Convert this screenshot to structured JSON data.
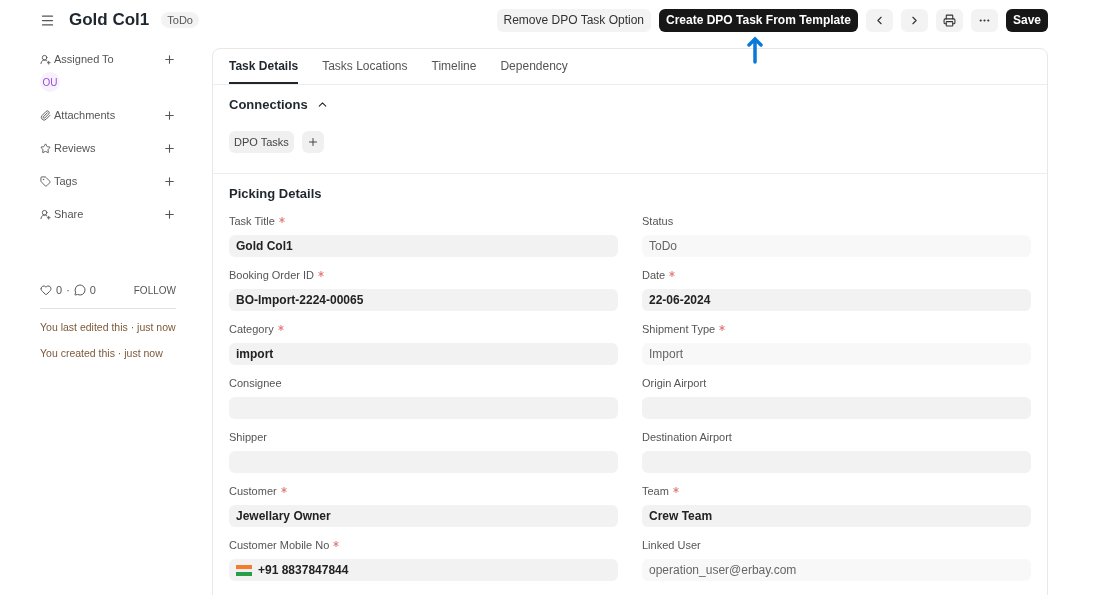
{
  "header": {
    "title": "Gold Col1",
    "status_badge": "ToDo",
    "buttons": [
      {
        "kind": "secondary",
        "label": "Remove DPO Task Option"
      },
      {
        "kind": "primary",
        "label": "Create DPO Task From Template"
      },
      {
        "kind": "icon"
      },
      {
        "kind": "icon"
      },
      {
        "kind": "icon"
      },
      {
        "kind": "icon"
      },
      {
        "kind": "primary",
        "label": "Save"
      }
    ]
  },
  "sidebar": {
    "items": [
      {
        "label": "Assigned To"
      },
      {
        "label": "Attachments"
      },
      {
        "label": "Reviews"
      },
      {
        "label": "Tags"
      },
      {
        "label": "Share"
      }
    ],
    "assignee": "OU",
    "likes": "0",
    "separator": "·",
    "comments": "0",
    "follow": "FOLLOW",
    "activity": [
      "You last edited this · just now",
      "You created this · just now"
    ]
  },
  "tabs": [
    {
      "label": "Task Details",
      "selected": true
    },
    {
      "label": "Tasks Locations",
      "selected": false
    },
    {
      "label": "Timeline",
      "selected": false
    },
    {
      "label": "Dependency",
      "selected": false
    }
  ],
  "connections": {
    "title": "Connections",
    "expanded": true,
    "items": [
      "DPO Tasks"
    ]
  },
  "section": {
    "title": "Picking Details",
    "fields": [
      {
        "label": "Task Title",
        "required": true,
        "value": "Gold Col1",
        "readonly": false
      },
      {
        "label": "Status",
        "required": false,
        "value": "ToDo",
        "readonly": true
      },
      {
        "label": "Booking Order ID",
        "required": true,
        "value": "BO-Import-2224-00065",
        "readonly": false
      },
      {
        "label": "Date",
        "required": true,
        "value": "22-06-2024",
        "readonly": false
      },
      {
        "label": "Category",
        "required": true,
        "value": "import",
        "readonly": false
      },
      {
        "label": "Shipment Type",
        "required": true,
        "value": "Import",
        "readonly": true
      },
      {
        "label": "Consignee",
        "required": false
      },
      {
        "label": "Origin Airport",
        "required": false
      },
      {
        "label": "Shipper",
        "required": false
      },
      {
        "label": "Destination Airport",
        "required": false
      },
      {
        "label": "Customer",
        "required": true,
        "value": "Jewellary Owner",
        "readonly": false
      },
      {
        "label": "Team",
        "required": true,
        "value": "Crew Team",
        "readonly": false
      },
      {
        "label": "Customer Mobile No",
        "required": true,
        "value": "+91 8837847844",
        "readonly": false,
        "kind": "phone"
      },
      {
        "label": "Linked User",
        "required": false,
        "value": "operation_user@erbay.com",
        "readonly": true
      }
    ]
  }
}
